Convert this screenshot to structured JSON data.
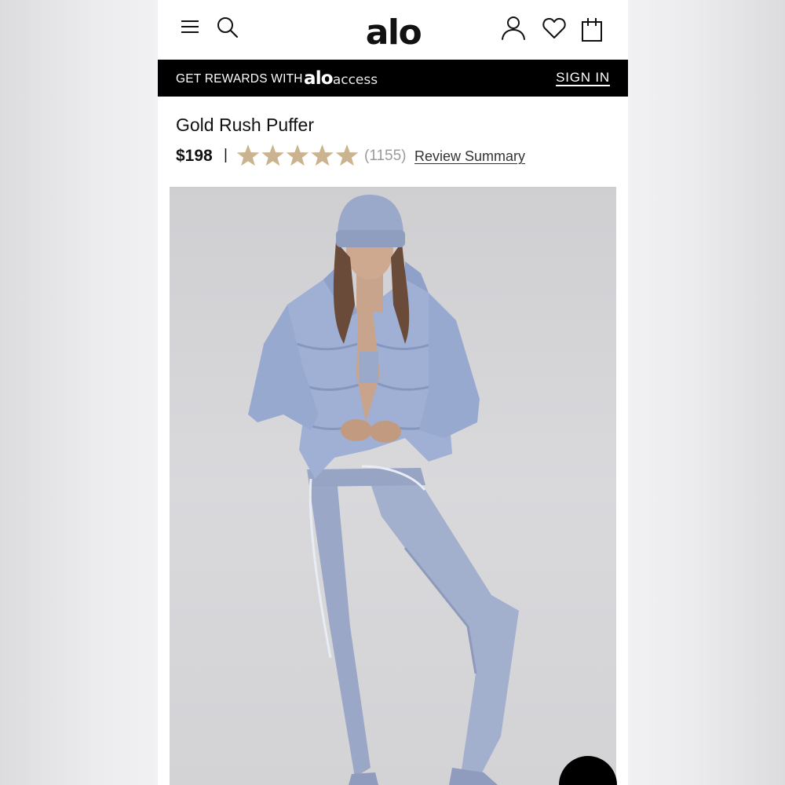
{
  "header": {
    "logo": "alo",
    "icons": [
      "menu-icon",
      "search-icon",
      "account-icon",
      "heart-icon",
      "bag-icon"
    ]
  },
  "rewards_bar": {
    "text": "GET REWARDS WITH",
    "logo_alo": "alo",
    "logo_access": "access",
    "sign_in": "SIGN IN"
  },
  "product": {
    "title": "Gold Rush Puffer",
    "price": "$198",
    "separator": "|",
    "rating": 5,
    "rating_max": 5,
    "review_count": "(1155)",
    "review_summary": "Review Summary"
  },
  "colors": {
    "star": "#cbb38f",
    "outfit": "#9aa8c9",
    "bar": "#000000"
  }
}
